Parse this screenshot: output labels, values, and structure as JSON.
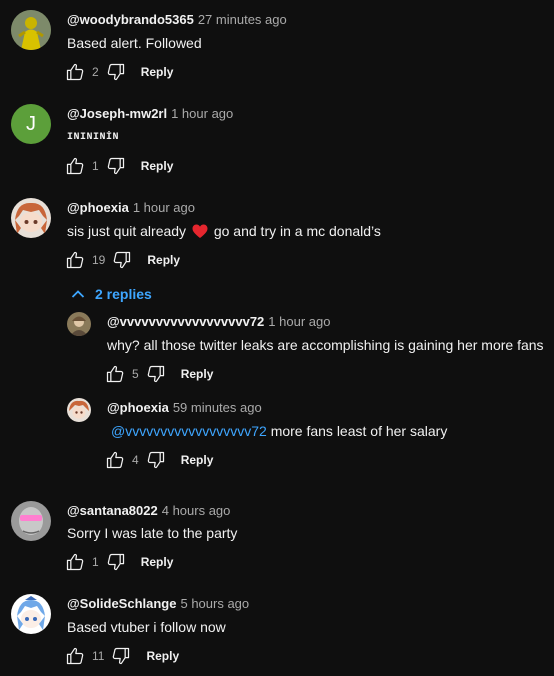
{
  "colors": {
    "background": "#0f0f0f",
    "text": "#f1f1f1",
    "muted": "#aaaaaa",
    "link": "#3ea6ff",
    "heart": "#e5262e",
    "avatar_j": "#5c9f3a"
  },
  "icons": {
    "like": "thumbs-up-icon",
    "dislike": "thumbs-down-icon",
    "collapse": "chevron-up-icon",
    "heart": "red-heart-emoji"
  },
  "comments": [
    {
      "author": "@woodybrando5365",
      "time": "27 minutes ago",
      "text": "Based alert. Followed",
      "likes": "2",
      "reply_label": "Reply"
    },
    {
      "author": "@Joseph-mw2rl",
      "time": "1 hour ago",
      "avatar_letter": "J",
      "text": "INININİN",
      "likes": "1",
      "reply_label": "Reply"
    },
    {
      "author": "@phoexia",
      "time": "1 hour ago",
      "text_before": "sis just quit already",
      "text_after": "go and try in a mc donald’s",
      "likes": "19",
      "reply_label": "Reply",
      "replies_toggle": "2 replies",
      "replies": [
        {
          "author": "@vvvvvvvvvvvvvvvvvv72",
          "time": "1 hour ago",
          "text": "why? all those twitter leaks are accomplishing is gaining her more fans",
          "likes": "5",
          "reply_label": "Reply"
        },
        {
          "author": "@phoexia",
          "time": "59 minutes ago",
          "mention": "@vvvvvvvvvvvvvvvvvv72",
          "text": "more fans least of her salary",
          "likes": "4",
          "reply_label": "Reply"
        }
      ]
    },
    {
      "author": "@santana8022",
      "time": "4 hours ago",
      "text": "Sorry I was late to the party",
      "likes": "1",
      "reply_label": "Reply"
    },
    {
      "author": "@SolideSchlange",
      "time": "5 hours ago",
      "text": "Based vtuber i follow now",
      "likes": "11",
      "reply_label": "Reply"
    }
  ]
}
